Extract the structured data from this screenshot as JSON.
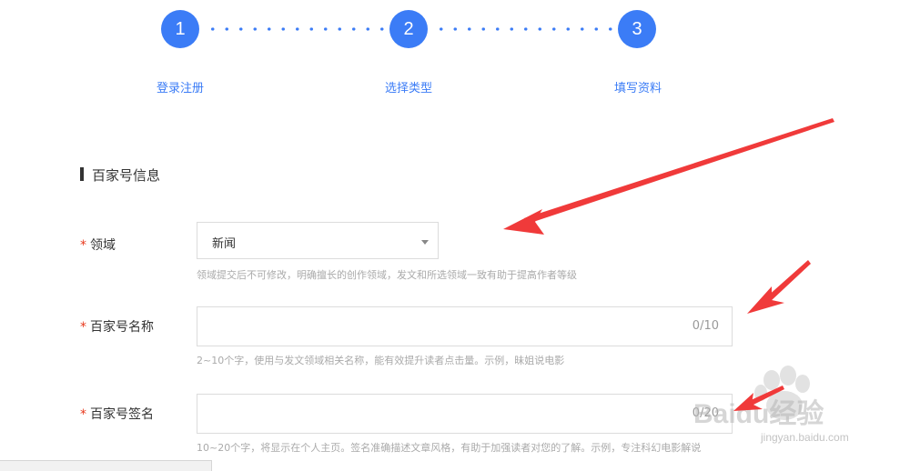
{
  "steps": [
    {
      "number": "1",
      "label": "登录注册"
    },
    {
      "number": "2",
      "label": "选择类型"
    },
    {
      "number": "3",
      "label": "填写资料"
    }
  ],
  "section": {
    "title": "百家号信息"
  },
  "form": {
    "required_mark": "*",
    "field_domain": {
      "label": "领域",
      "value": "新闻",
      "hint": "领域提交后不可修改，明确擅长的创作领域，发文和所选领域一致有助于提高作者等级"
    },
    "field_name": {
      "label": "百家号名称",
      "value": "",
      "counter": "0/10",
      "hint": "2~10个字，使用与发文领域相关名称，能有效提升读者点击量。示例，昧姐说电影"
    },
    "field_signature": {
      "label": "百家号签名",
      "value": "",
      "counter": "0/20",
      "hint": "10~20个字，将显示在个人主页。签名准确描述文章风格，有助于加强读者对您的了解。示例，专注科幻电影解说"
    }
  },
  "watermark": {
    "text": "Baidu经验",
    "url_text": "jingyan.baidu.com"
  },
  "colors": {
    "accent": "#3b7cf6",
    "required": "#e8391d",
    "arrow": "#f03a3a"
  }
}
